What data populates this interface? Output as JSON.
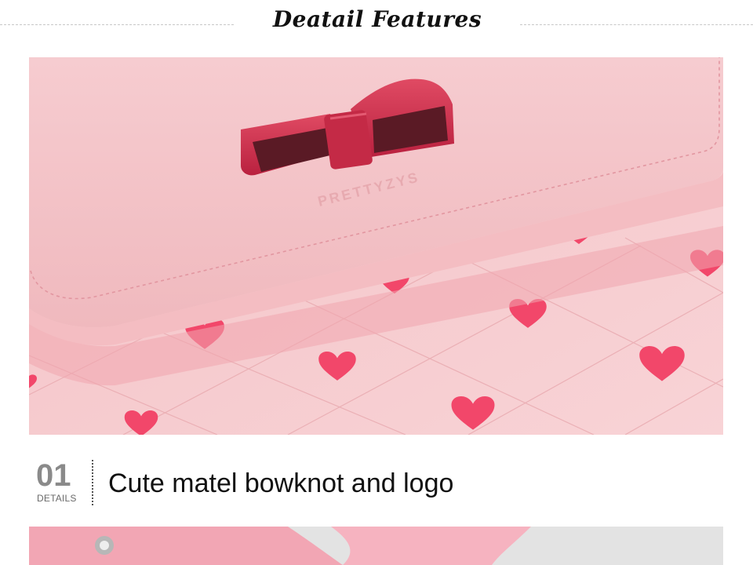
{
  "header": {
    "title": "Deatail Features"
  },
  "photo": {
    "logo_text": "PRETTYZYS",
    "colors": {
      "leather": "#f3c5c8",
      "heart": "#f2476a",
      "bow": "#d2334f"
    }
  },
  "detail": {
    "number": "01",
    "label": "DETAILS",
    "caption": "Cute matel bowknot and logo"
  }
}
